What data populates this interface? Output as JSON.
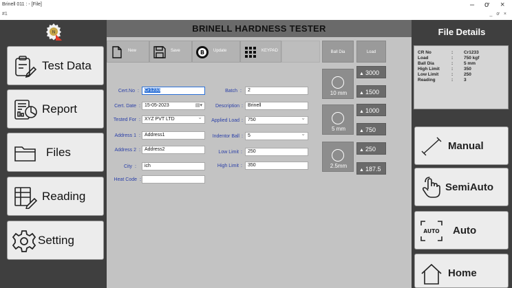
{
  "window": {
    "title": "Brinell 011 : - [File]",
    "mdi_icon": "#1",
    "min_glyph": "–",
    "max_glyph": "ơ",
    "close_glyph": "×",
    "mdi_controls": "_ ơ ×"
  },
  "nav": {
    "items": [
      {
        "label": "Test Data",
        "icon": "test-data-icon"
      },
      {
        "label": "Report",
        "icon": "report-icon"
      },
      {
        "label": "Files",
        "icon": "folder-icon"
      },
      {
        "label": "Reading",
        "icon": "reading-icon"
      },
      {
        "label": "Setting",
        "icon": "gear-icon"
      }
    ]
  },
  "header": {
    "title": "BRINELL HARDNESS TESTER"
  },
  "toolbar": {
    "new_label": "New",
    "save_label": "Save",
    "update_label": "Update",
    "keypad_label": "KEYPAD",
    "ball_dia_label": "Ball Dia",
    "load_label": "Load"
  },
  "form": {
    "cert_no_label": "Cert.No",
    "cert_no_value": "Cr1233",
    "cert_date_label": "Cert. Date",
    "cert_date_value": "15-05-2023",
    "tested_for_label": "Tested For",
    "tested_for_value": "XYZ PVT LTD",
    "address1_label": "Address 1",
    "address1_value": "Address1",
    "address2_label": "Address 2",
    "address2_value": "Address2",
    "city_label": "City",
    "city_value": "ich",
    "heat_code_label": "Heat Code",
    "heat_code_value": "",
    "batch_label": "Batch",
    "batch_value": "2",
    "description_label": "Description",
    "description_value": "Brinell",
    "applied_load_label": "Applied Load",
    "applied_load_value": "750",
    "indentor_ball_label": "Indentor Ball",
    "indentor_ball_value": "5",
    "low_limit_label": "Low Limit",
    "low_limit_value": "250",
    "high_limit_label": "High Limit",
    "high_limit_value": "350",
    "sep": ":"
  },
  "ball_dia": [
    {
      "label": "10 mm"
    },
    {
      "label": "5 mm"
    },
    {
      "label": "2.5mm"
    }
  ],
  "loads": [
    "3000",
    "1500",
    "1000",
    "750",
    "250",
    "187.5"
  ],
  "file_details": {
    "title": "File Details",
    "rows": [
      {
        "key": "CR No",
        "value": "Cr1233"
      },
      {
        "key": "Load",
        "value": "750 kgf"
      },
      {
        "key": "Ball Dia",
        "value": "5 mm"
      },
      {
        "key": "High Limit",
        "value": "350"
      },
      {
        "key": "Low Limit",
        "value": "250"
      },
      {
        "key": "Reading",
        "value": "3"
      }
    ],
    "sep": ":"
  },
  "modes": {
    "manual_label": "Manual",
    "semiauto_label": "SemiAuto",
    "auto_label": "Auto",
    "auto_icon_text": "AUTO",
    "home_label": "Home"
  },
  "colors": {
    "panel_dark": "#3f3f3f",
    "center_bg": "#c3c3c3",
    "label_blue": "#2a3fa8",
    "selection_blue": "#2a6fd6",
    "logo_red": "#e03b2a"
  }
}
